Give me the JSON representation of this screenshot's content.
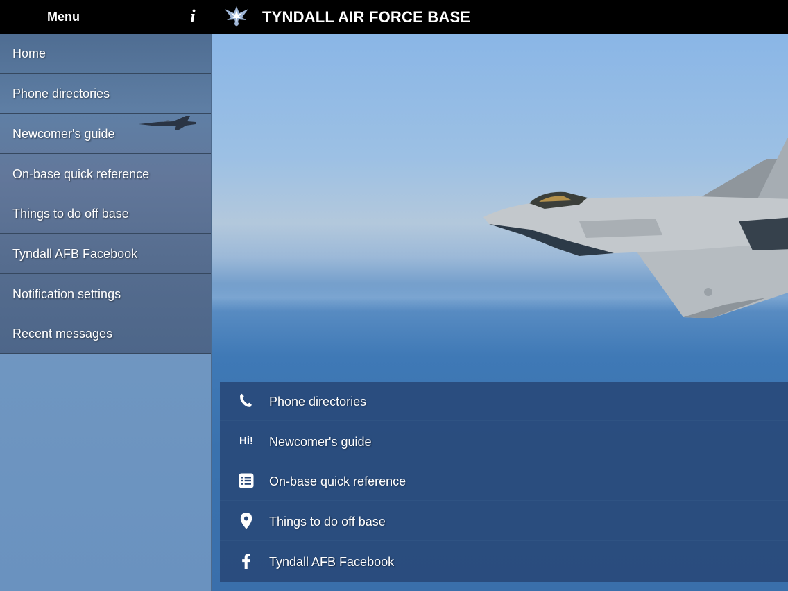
{
  "header": {
    "menu_label": "Menu",
    "info_label": "i",
    "app_title": "TYNDALL AIR FORCE BASE",
    "logo_icon": "air-force-wings-logo"
  },
  "sidebar": {
    "items": [
      {
        "label": "Home"
      },
      {
        "label": "Phone directories"
      },
      {
        "label": "Newcomer's guide"
      },
      {
        "label": "On-base quick reference"
      },
      {
        "label": "Things to do off base"
      },
      {
        "label": "Tyndall AFB Facebook"
      },
      {
        "label": "Notification settings"
      },
      {
        "label": "Recent messages"
      }
    ]
  },
  "quick_links": [
    {
      "icon": "phone-icon",
      "label": "Phone directories"
    },
    {
      "icon": "hi-badge-icon",
      "icon_text": "Hi!",
      "label": "Newcomer's guide"
    },
    {
      "icon": "list-icon",
      "label": "On-base quick reference"
    },
    {
      "icon": "map-pin-icon",
      "label": "Things to do off base"
    },
    {
      "icon": "facebook-icon",
      "label": "Tyndall AFB Facebook"
    }
  ],
  "colors": {
    "topbar": "#000000",
    "quick_panel": "#284878",
    "sky": "#8ab6e6",
    "sea": "#3a72ae"
  }
}
